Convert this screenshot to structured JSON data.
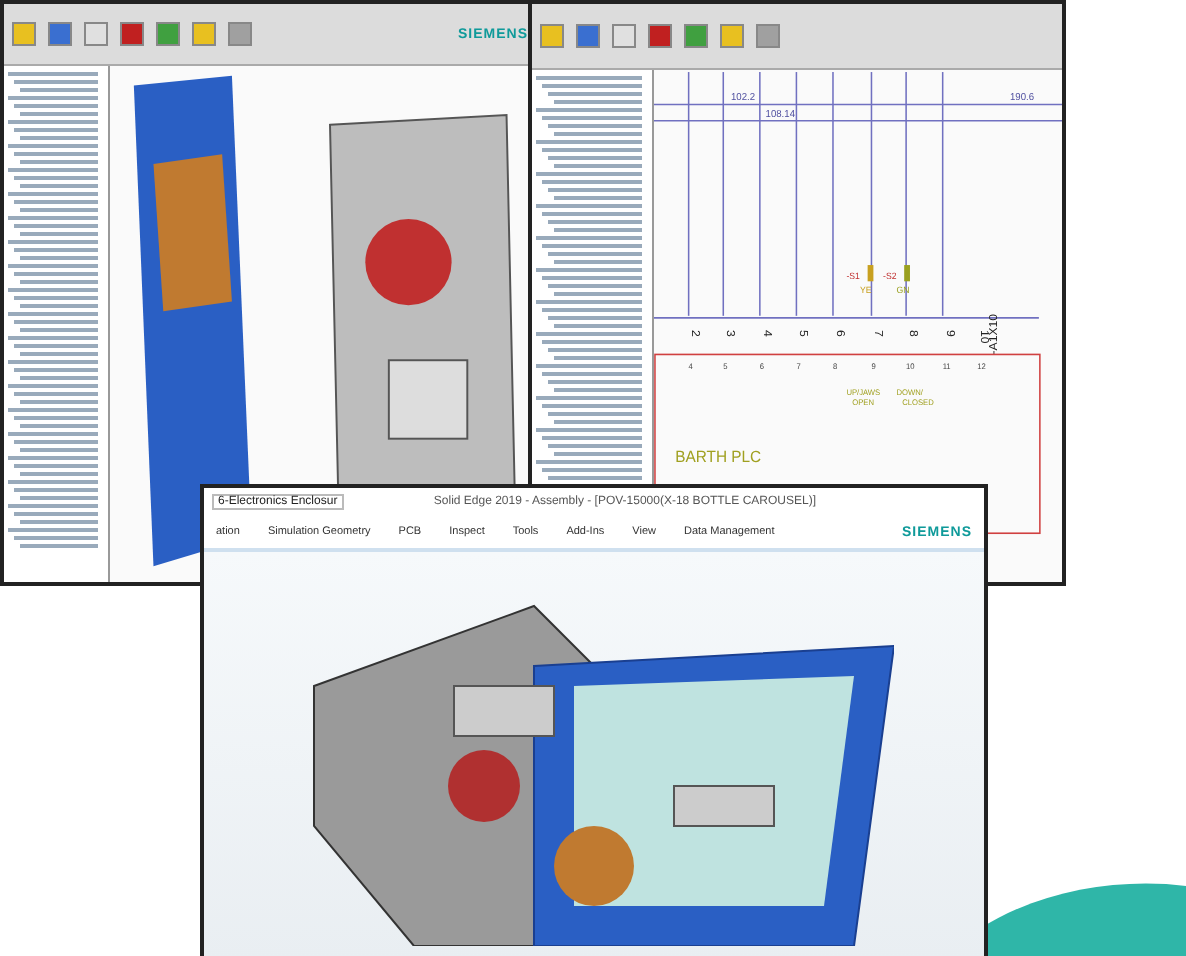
{
  "left_window": {
    "brand": "SIEMENS"
  },
  "schematic_window": {
    "wire_labels": [
      "102.2",
      "190.6",
      "108.14"
    ],
    "terminals": [
      "2",
      "3",
      "4",
      "5",
      "6",
      "7",
      "8",
      "9",
      "10"
    ],
    "terminal_strip": "-A1X10",
    "columns": [
      "4",
      "5",
      "6",
      "7",
      "8",
      "9",
      "10",
      "11",
      "12"
    ],
    "switches": [
      {
        "name": "-S1",
        "code": "YE",
        "color": "#c8a020"
      },
      {
        "name": "-S2",
        "code": "GN",
        "color": "#9aa020"
      }
    ],
    "notes": [
      {
        "lines": [
          "UP/JAWS",
          "OPEN"
        ]
      },
      {
        "lines": [
          "DOWN/",
          "CLOSED"
        ]
      }
    ],
    "title": "BARTH PLC"
  },
  "front_window": {
    "document": "6-Electronics Enclosur",
    "title": "Solid Edge 2019 - Assembly - [POV-15000(X-18 BOTTLE CAROUSEL)]",
    "tabs": [
      "ation",
      "Simulation Geometry",
      "PCB",
      "Inspect",
      "Tools",
      "Add-Ins",
      "View",
      "Data Management"
    ],
    "brand": "SIEMENS"
  }
}
